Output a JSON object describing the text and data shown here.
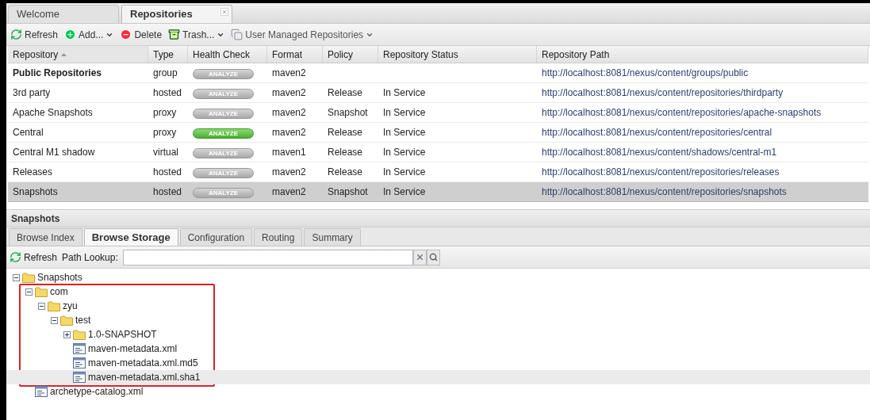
{
  "tabs": [
    {
      "label": "Welcome",
      "selected": false,
      "closable": false
    },
    {
      "label": "Repositories",
      "selected": true,
      "closable": true
    }
  ],
  "toolbar": [
    {
      "label": "Refresh",
      "kind": "refresh",
      "menu": false
    },
    {
      "label": "Add...",
      "kind": "add",
      "menu": true
    },
    {
      "label": "Delete",
      "kind": "delete",
      "menu": false
    },
    {
      "label": "Trash...",
      "kind": "trash",
      "menu": true
    },
    {
      "label": "User Managed Repositories",
      "kind": "user",
      "menu": true
    }
  ],
  "table": {
    "columns": [
      {
        "label": "Repository",
        "sorted": true
      },
      {
        "label": "Type",
        "sorted": false
      },
      {
        "label": "Health Check",
        "sorted": false
      },
      {
        "label": "Format",
        "sorted": false
      },
      {
        "label": "Policy",
        "sorted": false
      },
      {
        "label": "Repository Status",
        "sorted": false
      },
      {
        "label": "Repository Path",
        "sorted": false
      }
    ],
    "rows": [
      {
        "name": "Public Repositories",
        "bold": true,
        "type": "group",
        "analyze": "ANALYZE",
        "analyze_active": false,
        "format": "maven2",
        "policy": "",
        "status": "",
        "path": "http://localhost:8081/nexus/content/groups/public",
        "selected": false
      },
      {
        "name": "3rd party",
        "bold": false,
        "type": "hosted",
        "analyze": "ANALYZE",
        "analyze_active": false,
        "format": "maven2",
        "policy": "Release",
        "status": "In Service",
        "path": "http://localhost:8081/nexus/content/repositories/thirdparty",
        "selected": false
      },
      {
        "name": "Apache Snapshots",
        "bold": false,
        "type": "proxy",
        "analyze": "ANALYZE",
        "analyze_active": false,
        "format": "maven2",
        "policy": "Snapshot",
        "status": "In Service",
        "path": "http://localhost:8081/nexus/content/repositories/apache-snapshots",
        "selected": false
      },
      {
        "name": "Central",
        "bold": false,
        "type": "proxy",
        "analyze": "ANALYZE",
        "analyze_active": true,
        "format": "maven2",
        "policy": "Release",
        "status": "In Service",
        "path": "http://localhost:8081/nexus/content/repositories/central",
        "selected": false
      },
      {
        "name": "Central M1 shadow",
        "bold": false,
        "type": "virtual",
        "analyze": "ANALYZE",
        "analyze_active": false,
        "format": "maven1",
        "policy": "Release",
        "status": "In Service",
        "path": "http://localhost:8081/nexus/content/shadows/central-m1",
        "selected": false
      },
      {
        "name": "Releases",
        "bold": false,
        "type": "hosted",
        "analyze": "ANALYZE",
        "analyze_active": false,
        "format": "maven2",
        "policy": "Release",
        "status": "In Service",
        "path": "http://localhost:8081/nexus/content/repositories/releases",
        "selected": false
      },
      {
        "name": "Snapshots",
        "bold": false,
        "type": "hosted",
        "analyze": "ANALYZE",
        "analyze_active": false,
        "format": "maven2",
        "policy": "Snapshot",
        "status": "In Service",
        "path": "http://localhost:8081/nexus/content/repositories/snapshots",
        "selected": true
      }
    ]
  },
  "detail": {
    "title": "Snapshots",
    "tabs": [
      {
        "label": "Browse Index",
        "selected": false
      },
      {
        "label": "Browse Storage",
        "selected": true
      },
      {
        "label": "Configuration",
        "selected": false
      },
      {
        "label": "Routing",
        "selected": false
      },
      {
        "label": "Summary",
        "selected": false
      }
    ],
    "refresh": "Refresh",
    "path_lookup_label": "Path Lookup:",
    "tree": [
      {
        "label": "Snapshots",
        "kind": "folder",
        "expanded": true,
        "highlighted": false,
        "selected": false,
        "children": [
          {
            "label": "com",
            "kind": "folder",
            "expanded": true,
            "highlighted": true,
            "selected": false,
            "children": [
              {
                "label": "zyu",
                "kind": "folder",
                "expanded": true,
                "highlighted": false,
                "selected": false,
                "children": [
                  {
                    "label": "test",
                    "kind": "folder",
                    "expanded": true,
                    "highlighted": false,
                    "selected": false,
                    "children": [
                      {
                        "label": "1.0-SNAPSHOT",
                        "kind": "folder",
                        "expanded": false,
                        "highlighted": false,
                        "selected": false
                      },
                      {
                        "label": "maven-metadata.xml",
                        "kind": "file",
                        "highlighted": false,
                        "selected": false
                      },
                      {
                        "label": "maven-metadata.xml.md5",
                        "kind": "file",
                        "highlighted": false,
                        "selected": false
                      },
                      {
                        "label": "maven-metadata.xml.sha1",
                        "kind": "file",
                        "highlighted": false,
                        "selected": true
                      }
                    ]
                  }
                ]
              }
            ]
          },
          {
            "label": "archetype-catalog.xml",
            "kind": "file",
            "highlighted": false,
            "selected": false
          }
        ]
      }
    ]
  }
}
